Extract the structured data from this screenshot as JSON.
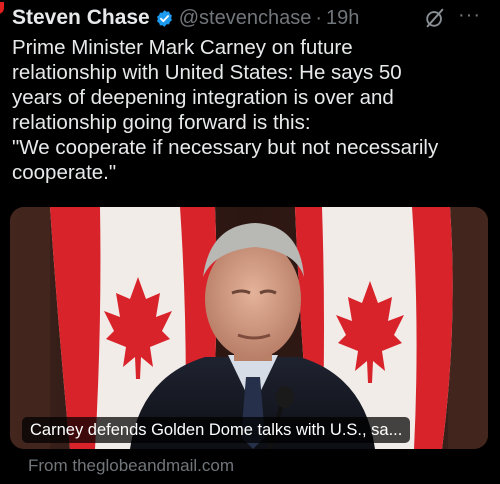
{
  "post": {
    "author": {
      "display_name": "Steven Chase",
      "handle": "@stevenchase",
      "separator": "·",
      "time": "19h",
      "verified_icon": "verified-badge-icon",
      "verified_color": "#1d9bf0"
    },
    "actions": {
      "grok_icon": "grok-icon",
      "more_icon": "more-options-icon",
      "more_label": "···"
    },
    "text_lines": [
      "Prime Minister Mark Carney on future",
      "relationship with United States: He says 50",
      "years of deepening integration is over and",
      "relationship going forward is this:",
      "\"We cooperate if necessary but not necessarily",
      "cooperate.\""
    ],
    "card": {
      "headline": "Carney defends Golden Dome talks with U.S., sa...",
      "source": "From theglobeandmail.com",
      "image_description_icon": "news-photo"
    },
    "colors": {
      "background": "#000000",
      "text": "#e7e9ea",
      "secondary": "#71767b",
      "flag_red": "#e1262a"
    }
  }
}
